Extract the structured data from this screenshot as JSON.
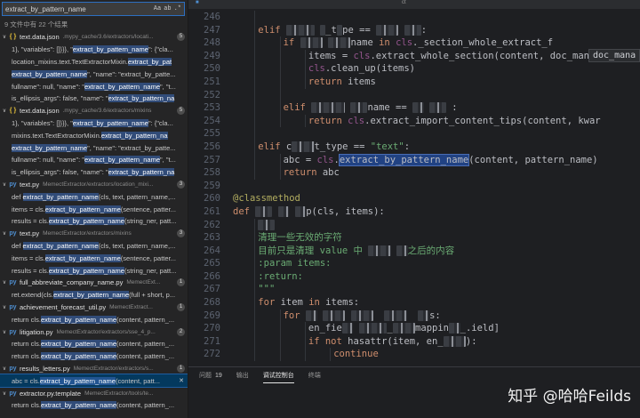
{
  "search": {
    "query": "extract_by_pattern_name",
    "opt_case": "Aa",
    "opt_word": "ab",
    "opt_regex": ".*",
    "summary": "9 文件中有 22 个结果"
  },
  "results": [
    {
      "kind": "file",
      "icon": "{ }",
      "type": "json",
      "name": "text.data.json",
      "path": ".mypy_cache/3.6/extractors/locati...",
      "count": "5"
    },
    {
      "kind": "match",
      "pre": "1}, \"variables\": []}}}, \"",
      "hit": "extract_by_pattern_name",
      "post": "\": {\"cla..."
    },
    {
      "kind": "match",
      "pre": "location_mixins.text.TextExtractorMixin.",
      "hit": "extract_by_pat",
      "post": ""
    },
    {
      "kind": "match",
      "pre": "",
      "hit": "extract_by_pattern_name",
      "post": "\", \"name\": \"extract_by_patte..."
    },
    {
      "kind": "match",
      "pre": "fullname\": null, \"name\": \"",
      "hit": "extract_by_pattern_name",
      "post": "\", \"t..."
    },
    {
      "kind": "match",
      "pre": "is_ellipsis_args\": false, \"name\": \"",
      "hit": "extract_by_pattern_na",
      "post": ""
    },
    {
      "kind": "file",
      "icon": "{ }",
      "type": "json",
      "name": "text.data.json",
      "path": ".mypy_cache/3.6/extractors/mixins",
      "count": "5"
    },
    {
      "kind": "match",
      "pre": "1}, \"variables\": []}}}, \"",
      "hit": "extract_by_pattern_name",
      "post": "\": {\"cla..."
    },
    {
      "kind": "match",
      "pre": "mixins.text.TextExtractorMixin.",
      "hit": "extract_by_pattern_na",
      "post": ""
    },
    {
      "kind": "match",
      "pre": "",
      "hit": "extract_by_pattern_name",
      "post": "\", \"name\": \"extract_by_patte..."
    },
    {
      "kind": "match",
      "pre": "fullname\": null, \"name\": \"",
      "hit": "extract_by_pattern_name",
      "post": "\", \"t..."
    },
    {
      "kind": "match",
      "pre": "is_ellipsis_args\": false, \"name\": \"",
      "hit": "extract_by_pattern_na",
      "post": ""
    },
    {
      "kind": "file",
      "icon": "py",
      "type": "py",
      "name": "text.py",
      "path": "MemectExtractor/extractors/location_mixi...",
      "count": "3"
    },
    {
      "kind": "match",
      "pre": "def ",
      "hit": "extract_by_pattern_name",
      "post": "(cls, text, pattern_name,..."
    },
    {
      "kind": "match",
      "pre": "items = cls.",
      "hit": "extract_by_pattern_name",
      "post": "(sentence, patter..."
    },
    {
      "kind": "match",
      "pre": "results = cls.",
      "hit": "extract_by_pattern_name",
      "post": "(string_ner, patt..."
    },
    {
      "kind": "file",
      "icon": "py",
      "type": "py",
      "name": "text.py",
      "path": "MemectExtractor/extractors/mixins",
      "count": "3"
    },
    {
      "kind": "match",
      "pre": "def ",
      "hit": "extract_by_pattern_name",
      "post": "(cls, text, pattern_name,..."
    },
    {
      "kind": "match",
      "pre": "items = cls.",
      "hit": "extract_by_pattern_name",
      "post": "(sentence, patter..."
    },
    {
      "kind": "match",
      "pre": "results = cls.",
      "hit": "extract_by_pattern_name",
      "post": "(string_ner, patt..."
    },
    {
      "kind": "file",
      "icon": "py",
      "type": "py",
      "name": "full_abbreviate_company_name.py",
      "path": "MemectExt...",
      "count": "1"
    },
    {
      "kind": "match",
      "pre": "ret.extend(cls.",
      "hit": "extract_by_pattern_name",
      "post": "(full + short, p..."
    },
    {
      "kind": "file",
      "icon": "py",
      "type": "py",
      "name": "achievement_forecast_util.py",
      "path": "MemectExtract...",
      "count": "1"
    },
    {
      "kind": "match",
      "pre": "return cls.",
      "hit": "extract_by_pattern_name",
      "post": "(content, pattern_..."
    },
    {
      "kind": "file",
      "icon": "py",
      "type": "py",
      "name": "litigation.py",
      "path": "MemectExtractor/extractors/sse_4_p...",
      "count": "2"
    },
    {
      "kind": "match",
      "pre": "return cls.",
      "hit": "extract_by_pattern_name",
      "post": "(content, pattern_..."
    },
    {
      "kind": "match",
      "pre": "return cls.",
      "hit": "extract_by_pattern_name",
      "post": "(content, pattern_..."
    },
    {
      "kind": "file",
      "icon": "py",
      "type": "py",
      "name": "results_letters.py",
      "path": "MemectExtractor/extractors/s...",
      "count": "1"
    },
    {
      "kind": "match",
      "selected": true,
      "pre": "abc = cls.",
      "hit": "extract_by_pattern_name",
      "post": "(content, patt..."
    },
    {
      "kind": "file",
      "icon": "py",
      "type": "tpl",
      "name": "extractor.py.template",
      "path": "MemectExtractor/tools/te...",
      "count": ""
    },
    {
      "kind": "match",
      "pre": "return cls.",
      "hit": "extract_by_pattern_name",
      "post": "(content, pattern_..."
    }
  ],
  "editor": {
    "tab_label": "ct",
    "hint": "doc_mana",
    "lines": [
      {
        "n": "246",
        "indent": 2,
        "t": [
          [
            "",
            ""
          ]
        ]
      },
      {
        "n": "247",
        "indent": 2,
        "t": [
          [
            "kw",
            "elif "
          ],
          [
            "blur",
            "c    "
          ],
          [
            "",
            " "
          ],
          [
            "blur",
            "t"
          ],
          [
            "",
            "_t"
          ],
          [
            "blur",
            "y"
          ],
          [
            "",
            "pe == "
          ],
          [
            "blur",
            "\"  _"
          ],
          [
            "",
            " "
          ],
          [
            "blur",
            "  \""
          ],
          [
            "",
            ":"
          ]
        ]
      },
      {
        "n": "248",
        "indent": 3,
        "t": [
          [
            "kw",
            "if "
          ],
          [
            "blur",
            "    "
          ],
          [
            "",
            " "
          ],
          [
            "blur",
            "    "
          ],
          [
            "",
            "name "
          ],
          [
            "kw",
            "in "
          ],
          [
            "self",
            "cls"
          ],
          [
            "",
            "._section_whole_extract_f"
          ]
        ]
      },
      {
        "n": "249",
        "indent": 4,
        "t": [
          [
            "",
            "items = "
          ],
          [
            "self",
            "cls"
          ],
          [
            "",
            ".extract_whole_section(content, doc_manag"
          ]
        ]
      },
      {
        "n": "250",
        "indent": 4,
        "t": [
          [
            "self",
            "cls"
          ],
          [
            "",
            ".clean_up(items)"
          ]
        ]
      },
      {
        "n": "251",
        "indent": 4,
        "t": [
          [
            "kw",
            "return "
          ],
          [
            "",
            "items"
          ]
        ]
      },
      {
        "n": "252",
        "indent": 3,
        "t": [
          [
            "",
            ""
          ]
        ]
      },
      {
        "n": "253",
        "indent": 3,
        "t": [
          [
            "kw",
            "elif "
          ],
          [
            "blur",
            "      "
          ],
          [
            "",
            " "
          ],
          [
            "blur",
            "   "
          ],
          [
            "",
            "name == "
          ],
          [
            "blur",
            "  "
          ],
          [
            "",
            " "
          ],
          [
            "blur",
            "   "
          ],
          [
            "",
            " :"
          ]
        ]
      },
      {
        "n": "254",
        "indent": 4,
        "t": [
          [
            "kw",
            "return "
          ],
          [
            "self",
            "cls"
          ],
          [
            "",
            ".extract_import_content_tips(content, kwar"
          ]
        ]
      },
      {
        "n": "255",
        "indent": 2,
        "t": [
          [
            "",
            ""
          ]
        ]
      },
      {
        "n": "256",
        "indent": 2,
        "t": [
          [
            "kw",
            "elif "
          ],
          [
            "",
            "c"
          ],
          [
            "blur",
            "    "
          ],
          [
            "",
            "t_type == "
          ],
          [
            "str",
            "\"text\""
          ],
          [
            "",
            ":"
          ]
        ]
      },
      {
        "n": "257",
        "indent": 3,
        "t": [
          [
            "",
            "abc = "
          ],
          [
            "self",
            "cls"
          ],
          [
            "",
            "."
          ],
          [
            "sel",
            "extract_by_pattern_name"
          ],
          [
            "",
            "(content, pattern_name)"
          ]
        ]
      },
      {
        "n": "258",
        "indent": 3,
        "t": [
          [
            "kw",
            "return "
          ],
          [
            "",
            "abc"
          ]
        ]
      },
      {
        "n": "259",
        "indent": 1,
        "t": [
          [
            "",
            ""
          ]
        ]
      },
      {
        "n": "260",
        "indent": 1,
        "t": [
          [
            "dec",
            "@classmethod"
          ]
        ]
      },
      {
        "n": "261",
        "indent": 1,
        "t": [
          [
            "kw",
            "def "
          ],
          [
            "blur",
            "   "
          ],
          [
            "",
            " "
          ],
          [
            "blur",
            "  "
          ],
          [
            "",
            " "
          ],
          [
            "blur",
            "  "
          ],
          [
            "",
            "p(cls, items):"
          ]
        ]
      },
      {
        "n": "262",
        "indent": 2,
        "t": [
          [
            "blur",
            "   "
          ]
        ]
      },
      {
        "n": "263",
        "indent": 2,
        "t": [
          [
            "cmt",
            "清理一些无效的字符"
          ]
        ]
      },
      {
        "n": "264",
        "indent": 2,
        "t": [
          [
            "cmt",
            "目前只是清理 value 中 "
          ],
          [
            "blur",
            "    "
          ],
          [
            "cmt",
            " "
          ],
          [
            "blur",
            "  "
          ],
          [
            "cmt",
            "之后的内容"
          ]
        ]
      },
      {
        "n": "265",
        "indent": 2,
        "t": [
          [
            "cmt",
            ":param items:"
          ]
        ]
      },
      {
        "n": "266",
        "indent": 2,
        "t": [
          [
            "cmt",
            ":return:"
          ]
        ]
      },
      {
        "n": "267",
        "indent": 2,
        "t": [
          [
            "cmt",
            "\"\"\""
          ]
        ]
      },
      {
        "n": "268",
        "indent": 2,
        "t": [
          [
            "kw",
            "for "
          ],
          [
            "",
            "item "
          ],
          [
            "kw",
            "in "
          ],
          [
            "",
            "items:"
          ]
        ]
      },
      {
        "n": "269",
        "indent": 3,
        "t": [
          [
            "kw",
            "for "
          ],
          [
            "blur",
            "  "
          ],
          [
            "",
            " "
          ],
          [
            "blur",
            "    "
          ],
          [
            "",
            " "
          ],
          [
            "blur",
            "    "
          ],
          [
            "",
            "  "
          ],
          [
            "blur",
            "    "
          ],
          [
            "",
            "  "
          ],
          [
            "blur",
            "  "
          ],
          [
            "",
            "s:"
          ]
        ]
      },
      {
        "n": "270",
        "indent": 4,
        "t": [
          [
            "",
            "en_fie"
          ],
          [
            "blur",
            "  "
          ],
          [
            "",
            " "
          ],
          [
            "blur",
            "     "
          ],
          [
            "",
            "_"
          ],
          [
            "blur",
            "    "
          ],
          [
            "",
            "mappin"
          ],
          [
            "blur",
            "  "
          ],
          [
            "",
            "_.ield]"
          ]
        ]
      },
      {
        "n": "271",
        "indent": 4,
        "t": [
          [
            "kw",
            "if not "
          ],
          [
            "",
            "hasattr(item, en_"
          ],
          [
            "blur",
            "    "
          ],
          [
            "",
            "):"
          ]
        ]
      },
      {
        "n": "272",
        "indent": 5,
        "t": [
          [
            "kw",
            "continue"
          ]
        ]
      }
    ]
  },
  "panel": {
    "tabs": [
      {
        "label": "问题",
        "badge": "19"
      },
      {
        "label": "输出",
        "badge": ""
      },
      {
        "label": "调试控制台",
        "badge": ""
      },
      {
        "label": "终端",
        "badge": ""
      }
    ],
    "active_tab": 2,
    "watermark": "知乎 @哈哈Feilds"
  }
}
